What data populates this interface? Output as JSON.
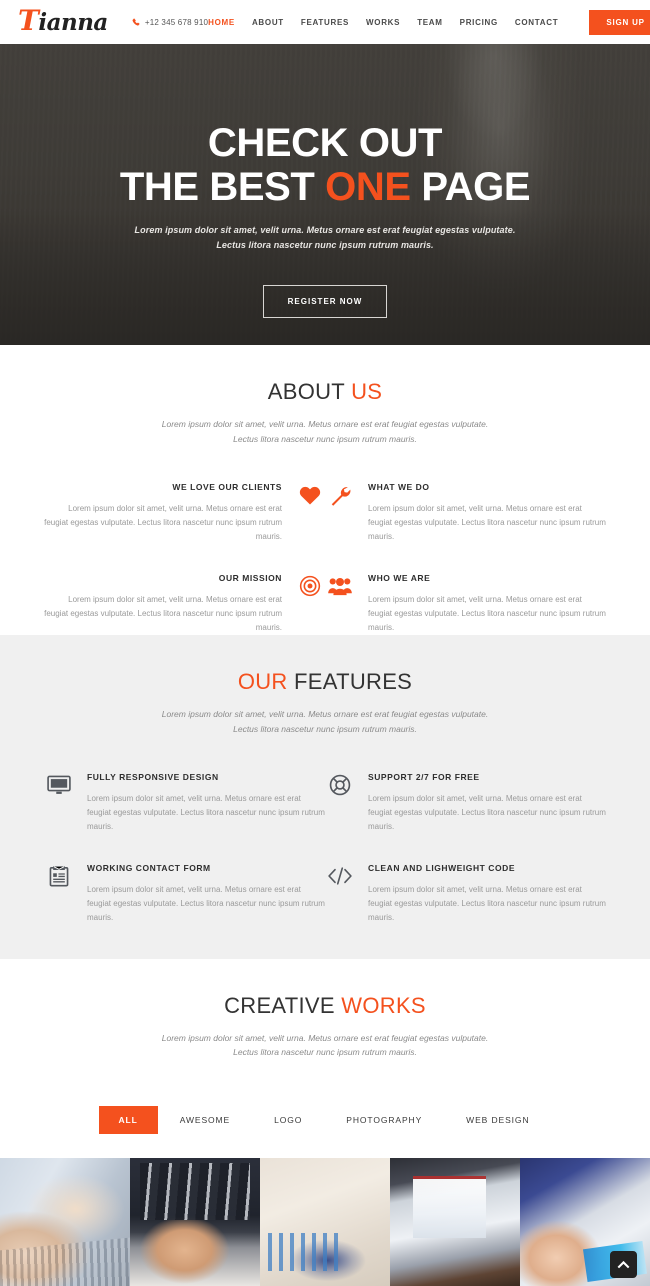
{
  "header": {
    "logo_initial": "T",
    "logo_rest": "ianna",
    "phone_icon": "phone-icon",
    "phone": "+12 345 678 910",
    "nav": [
      {
        "label": "HOME",
        "active": true
      },
      {
        "label": "ABOUT",
        "active": false
      },
      {
        "label": "FEATURES",
        "active": false
      },
      {
        "label": "WORKS",
        "active": false
      },
      {
        "label": "TEAM",
        "active": false
      },
      {
        "label": "PRICING",
        "active": false
      },
      {
        "label": "CONTACT",
        "active": false
      }
    ],
    "signup_label": "SIGN UP"
  },
  "hero": {
    "line1": "CHECK OUT",
    "line2_pre": "THE BEST ",
    "line2_accent": "ONE",
    "line2_post": " PAGE",
    "subtitle_line1": "Lorem ipsum dolor sit amet, velit urna. Metus ornare est erat feugiat egestas vulputate.",
    "subtitle_line2": "Lectus litora nascetur nunc ipsum rutrum mauris.",
    "cta_label": "REGISTER NOW"
  },
  "about": {
    "title_plain": "ABOUT ",
    "title_accent": "US",
    "subtitle": "Lorem ipsum dolor sit amet, velit urna. Metus ornare est erat feugiat egestas vulputate. Lectus litora nascetur nunc ipsum rutrum mauris.",
    "body_text": "Lorem ipsum dolor sit amet, velit urna. Metus ornare est erat feugiat egestas vulputate. Lectus litora nascetur nunc ipsum rutrum mauris.",
    "items": [
      {
        "title": "WE LOVE OUR CLIENTS",
        "icon": "heart-icon",
        "align": "right"
      },
      {
        "title": "WHAT WE DO",
        "icon": "wrench-icon",
        "align": "left"
      },
      {
        "title": "OUR MISSION",
        "icon": "target-icon",
        "align": "right"
      },
      {
        "title": "WHO WE ARE",
        "icon": "people-group-icon",
        "align": "left"
      }
    ]
  },
  "features": {
    "title_accent": "OUR",
    "title_plain": " FEATURES",
    "subtitle": "Lorem ipsum dolor sit amet, velit urna. Metus ornare est erat feugiat egestas vulputate. Lectus litora nascetur nunc ipsum rutrum mauris.",
    "body_text": "Lorem ipsum dolor sit amet, velit urna. Metus ornare est erat feugiat egestas vulputate. Lectus litora nascetur nunc ipsum rutrum mauris.",
    "items": [
      {
        "title": "FULLY RESPONSIVE DESIGN",
        "icon": "monitor-icon"
      },
      {
        "title": "SUPPORT 2/7 FOR FREE",
        "icon": "lifebuoy-icon"
      },
      {
        "title": "WORKING CONTACT FORM",
        "icon": "clipboard-form-icon"
      },
      {
        "title": "CLEAN AND LIGHWEIGHT CODE",
        "icon": "code-brackets-icon"
      }
    ]
  },
  "works": {
    "title_plain": "CREATIVE ",
    "title_accent": "WORKS",
    "subtitle": "Lorem ipsum dolor sit amet, velit urna. Metus ornare est erat feugiat egestas vulputate. Lectus litora nascetur nunc ipsum rutrum mauris.",
    "filters": [
      {
        "label": "ALL",
        "active": true
      },
      {
        "label": "AWESOME",
        "active": false
      },
      {
        "label": "LOGO",
        "active": false
      },
      {
        "label": "PHOTOGRAPHY",
        "active": false
      },
      {
        "label": "WEB DESIGN",
        "active": false
      }
    ],
    "gallery": [
      {
        "name": "hands-typing-on-laptops"
      },
      {
        "name": "business-team-and-signing-hand"
      },
      {
        "name": "eyeglasses-on-charts"
      },
      {
        "name": "person-working-on-laptop"
      },
      {
        "name": "hands-with-calculator-and-laptop"
      }
    ]
  },
  "scroll_top": {
    "icon": "chevron-up-icon"
  },
  "colors": {
    "accent": "#f4511e",
    "dark": "#2e2e2e",
    "muted": "#9a9a9a",
    "section_gray": "#f0f0f0"
  }
}
